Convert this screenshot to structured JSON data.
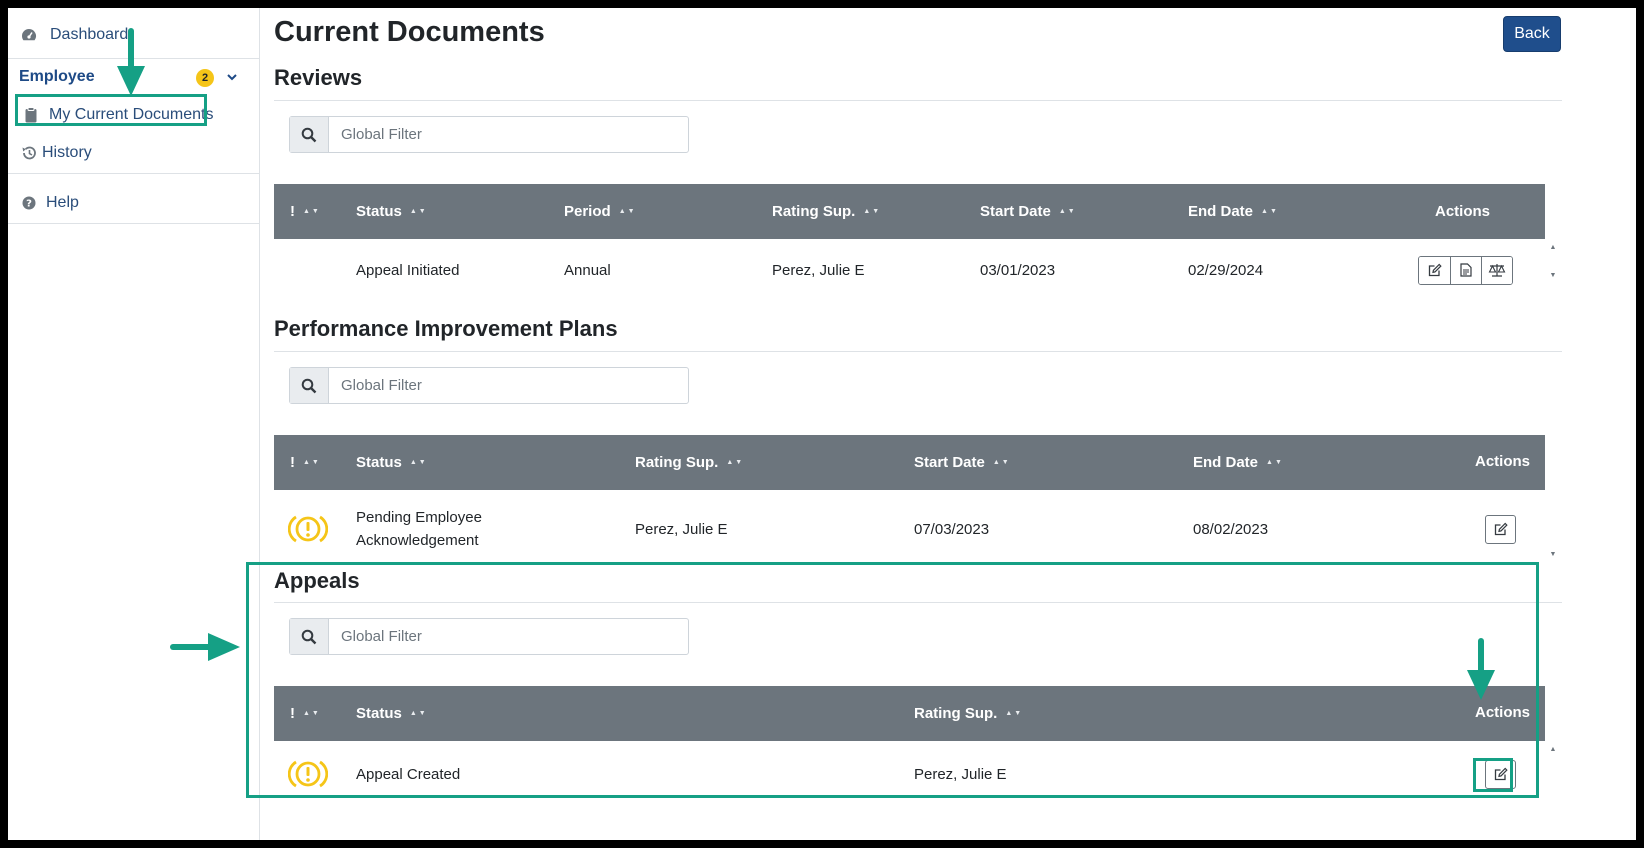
{
  "sidebar": {
    "dashboard": "Dashboard",
    "employee": "Employee",
    "employee_badge": "2",
    "my_current_documents": "My Current Documents",
    "history": "History",
    "help": "Help"
  },
  "page": {
    "title": "Current Documents",
    "back_label": "Back"
  },
  "reviews": {
    "title": "Reviews",
    "filter_placeholder": "Global Filter",
    "columns": [
      "!",
      "Status",
      "Period",
      "Rating Sup.",
      "Start Date",
      "End Date",
      "Actions"
    ],
    "rows": [
      {
        "status": "Appeal Initiated",
        "period": "Annual",
        "rating_sup": "Perez, Julie E",
        "start_date": "03/01/2023",
        "end_date": "02/29/2024",
        "actions": [
          "edit-icon",
          "document-icon",
          "scale-icon"
        ]
      }
    ]
  },
  "pips": {
    "title": "Performance Improvement Plans",
    "filter_placeholder": "Global Filter",
    "columns": [
      "!",
      "Status",
      "Rating Sup.",
      "Start Date",
      "End Date",
      "Actions"
    ],
    "rows": [
      {
        "alert": "alert-circle-icon",
        "status_line1": "Pending Employee",
        "status_line2": "Acknowledgement",
        "rating_sup": "Perez, Julie E",
        "start_date": "07/03/2023",
        "end_date": "08/02/2023",
        "actions": [
          "edit-icon"
        ]
      }
    ]
  },
  "appeals": {
    "title": "Appeals",
    "filter_placeholder": "Global Filter",
    "columns": [
      "!",
      "Status",
      "Rating Sup.",
      "Actions"
    ],
    "rows": [
      {
        "alert": "alert-circle-icon",
        "status": "Appeal Created",
        "rating_sup": "Perez, Julie E",
        "actions": [
          "edit-icon"
        ]
      }
    ]
  },
  "colors": {
    "header_gray": "#6c757d",
    "link_blue": "#2a4d7a",
    "back_button": "#1f4e8c",
    "badge_yellow": "#f5c518",
    "alert_yellow": "#f5c518",
    "annotation_teal": "#15a085"
  }
}
